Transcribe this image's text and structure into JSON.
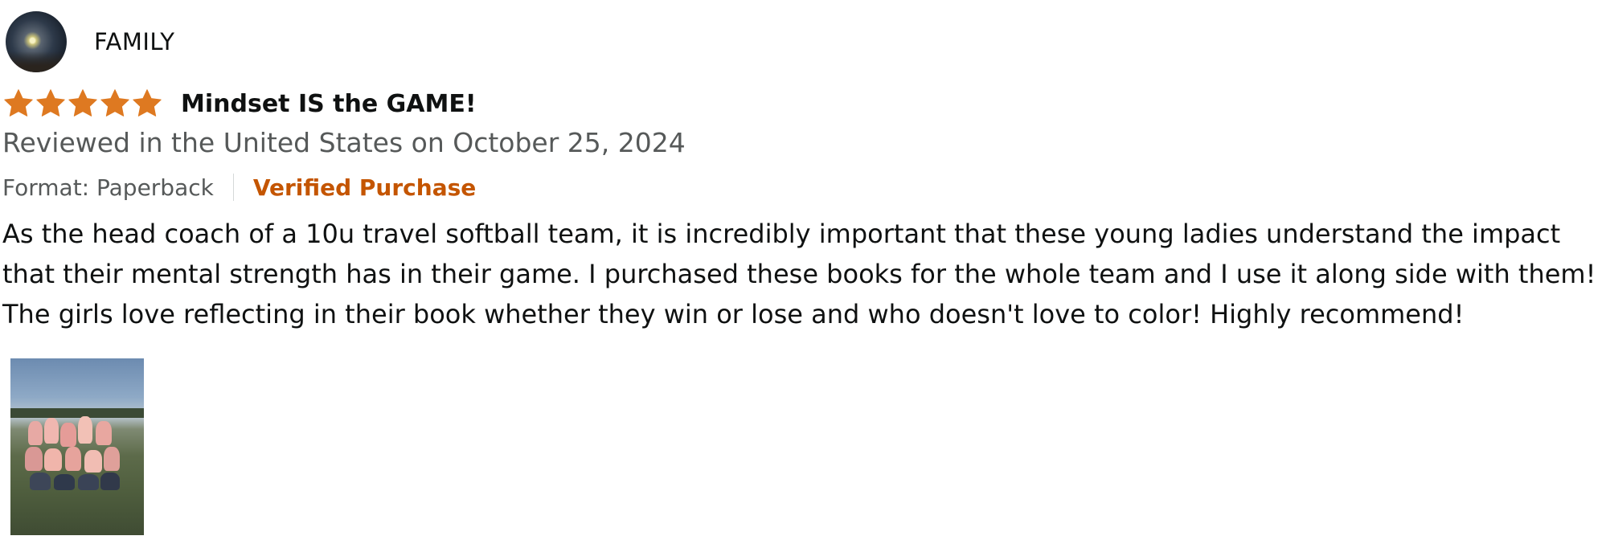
{
  "reviewer": {
    "name": "FAMILY"
  },
  "rating": {
    "stars": 5,
    "max": 5,
    "color": "#de7921"
  },
  "review": {
    "title": "Mindset IS the GAME!",
    "date_line": "Reviewed in the United States on October 25, 2024",
    "format": "Format: Paperback",
    "verified": "Verified Purchase",
    "body": "As the head coach of a 10u travel softball team, it is incredibly important that these young ladies understand the impact that their mental strength has in their game. I purchased these books for the whole team and I use it along side with them! The girls love reflecting in their book whether they win or lose and who doesn't love to color! Highly recommend!"
  },
  "colors": {
    "text": "#0f1111",
    "secondary_text": "#565959",
    "verified": "#c45500",
    "divider": "#d5d9d9"
  },
  "icons": {
    "star": "star-filled-icon"
  }
}
